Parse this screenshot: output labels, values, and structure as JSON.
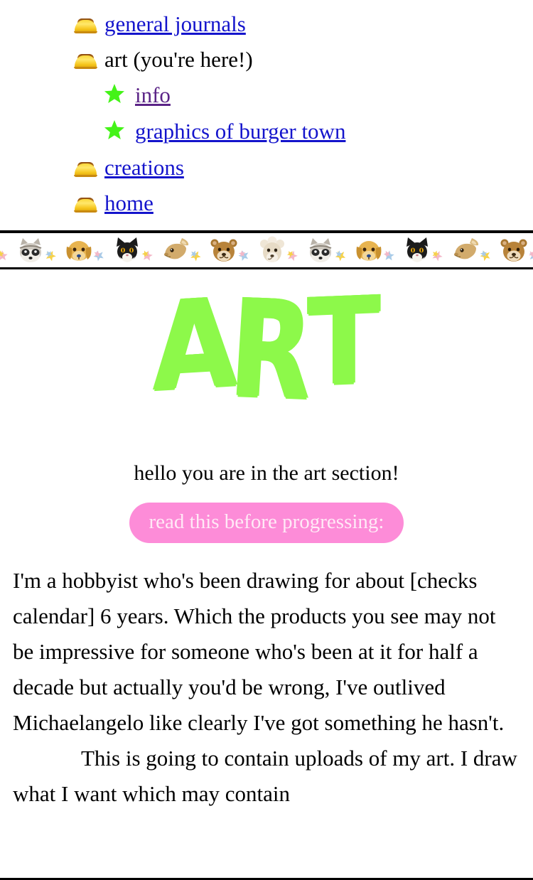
{
  "nav": {
    "items": [
      {
        "icon": "dome-icon",
        "label": "general journals",
        "link": true,
        "color": "blue",
        "level": 0
      },
      {
        "icon": "dome-icon",
        "label": "art (you're here!)",
        "link": false,
        "color": "black",
        "level": 0
      },
      {
        "icon": "star-icon",
        "label": "info",
        "link": true,
        "color": "purple",
        "level": 1
      },
      {
        "icon": "star-icon",
        "label": "graphics of burger town",
        "link": true,
        "color": "blue",
        "level": 1
      },
      {
        "icon": "dome-icon",
        "label": "creations",
        "link": true,
        "color": "blue",
        "level": 0
      },
      {
        "icon": "dome-icon",
        "label": "home",
        "link": true,
        "color": "blue",
        "level": 0
      }
    ]
  },
  "divider": {
    "name": "animal-sticker-border",
    "animals": [
      "raccoon",
      "dog",
      "cat",
      "rabbit",
      "bear",
      "sheep",
      "raccoon",
      "dog",
      "cat",
      "rabbit",
      "bear",
      "sheep"
    ],
    "sparkle_colors": [
      "#f4b8c8",
      "#f6d24a",
      "#a8cbe8"
    ]
  },
  "header": {
    "title": "ART",
    "title_letters": [
      "A",
      "R",
      "T"
    ],
    "title_color": "#8df94a"
  },
  "main": {
    "greeting": "hello you are in the art section!",
    "warning_pill": "read this before progressing:",
    "pill_color": "#fd8cd8",
    "paragraphs": [
      "I'm a hobbyist who's been drawing for about [checks calendar] 6 years. Which the products you see may not be impressive for someone who's been at it for half a decade but actually you'd be wrong, I've outlived Michaelangelo like clearly I've got something he hasn't.",
      "This is going to contain uploads of my art. I draw what I want which may contain"
    ]
  },
  "colors": {
    "link_blue": "#1414cc",
    "link_purple": "#5b2487",
    "accent_green": "#8df94a",
    "accent_pink": "#fd8cd8"
  }
}
